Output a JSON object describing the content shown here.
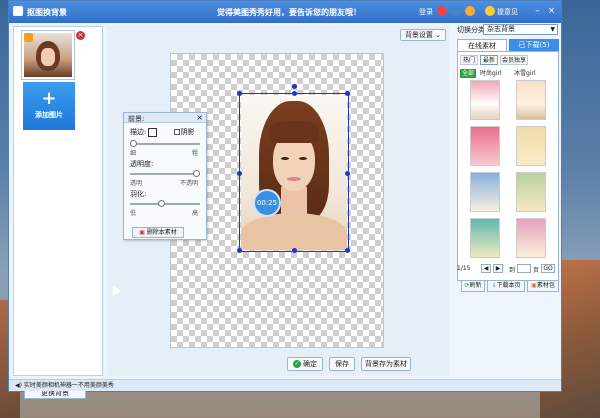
{
  "window": {
    "title": "抠图换背景",
    "slogan": "觉得美图秀秀好用，要告诉您的朋友哦！",
    "login": "登录",
    "feedback": "提意见"
  },
  "left_panel": {
    "add_image": "添加图片",
    "change_bg": "更换背景"
  },
  "canvas": {
    "bg_settings": "背景设置",
    "timer": "00:25"
  },
  "bg_panel": {
    "title": "前景:",
    "stroke": "描边:",
    "shadow": "阴影",
    "thin": "细",
    "thick": "粗",
    "transparency": "透明度:",
    "transparent": "透明",
    "opaque": "不透明",
    "feather": "羽化:",
    "low": "低",
    "high": "高",
    "delete": "删除本素材"
  },
  "actions": {
    "confirm": "确定",
    "save": "保存",
    "save_as_material": "背景存为素材"
  },
  "right_panel": {
    "switch_label": "切换分类",
    "category": "杂志背景",
    "tab_online": "在线素材",
    "tab_downloaded": "已下载(5)",
    "subtabs": [
      "热门",
      "最新",
      "会员独享"
    ],
    "filters": [
      "全部",
      "时尚girl",
      "冰雪girl"
    ],
    "pager_text": "1/15",
    "pager_jump": "到",
    "pager_page": "页",
    "go": "GO",
    "refresh": "刷新",
    "download_page": "下载本页",
    "material_pack": "素材包"
  },
  "statusbar": {
    "text": "实时美颜相机神器一不用美颜美秀"
  },
  "colors": {
    "titlebar": "#2f6fc8",
    "accent": "#3a8fe4",
    "active_filter": "#2aa040"
  }
}
